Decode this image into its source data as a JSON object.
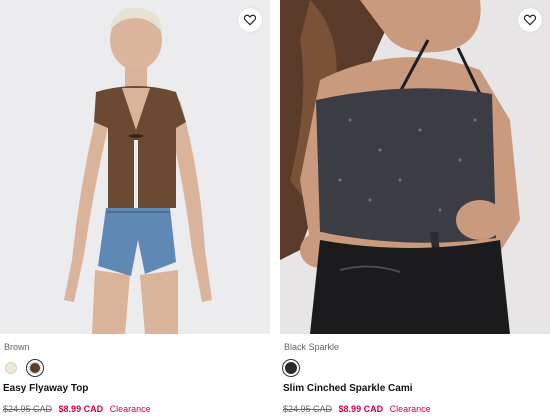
{
  "products": [
    {
      "color_name": "Brown",
      "swatches": [
        {
          "name": "cream",
          "color": "#eee9dc",
          "selected": false
        },
        {
          "name": "brown",
          "color": "#5a3d2b",
          "selected": true
        }
      ],
      "title": "Easy Flyaway Top",
      "original_price": "$24.95 CAD",
      "sale_price": "$8.99 CAD",
      "badge": "Clearance",
      "wishlist_icon": "heart-icon"
    },
    {
      "color_name": "Black Sparkle",
      "swatches": [
        {
          "name": "black-sparkle",
          "color": "#2b2b30",
          "selected": true
        }
      ],
      "title": "Slim Cinched Sparkle Cami",
      "original_price": "$24.95 CAD",
      "sale_price": "$8.99 CAD",
      "badge": "Clearance",
      "wishlist_icon": "heart-icon"
    }
  ],
  "colors": {
    "sale": "#d0004b",
    "muted_text": "#666666",
    "photo_bg": "#ecebee"
  }
}
